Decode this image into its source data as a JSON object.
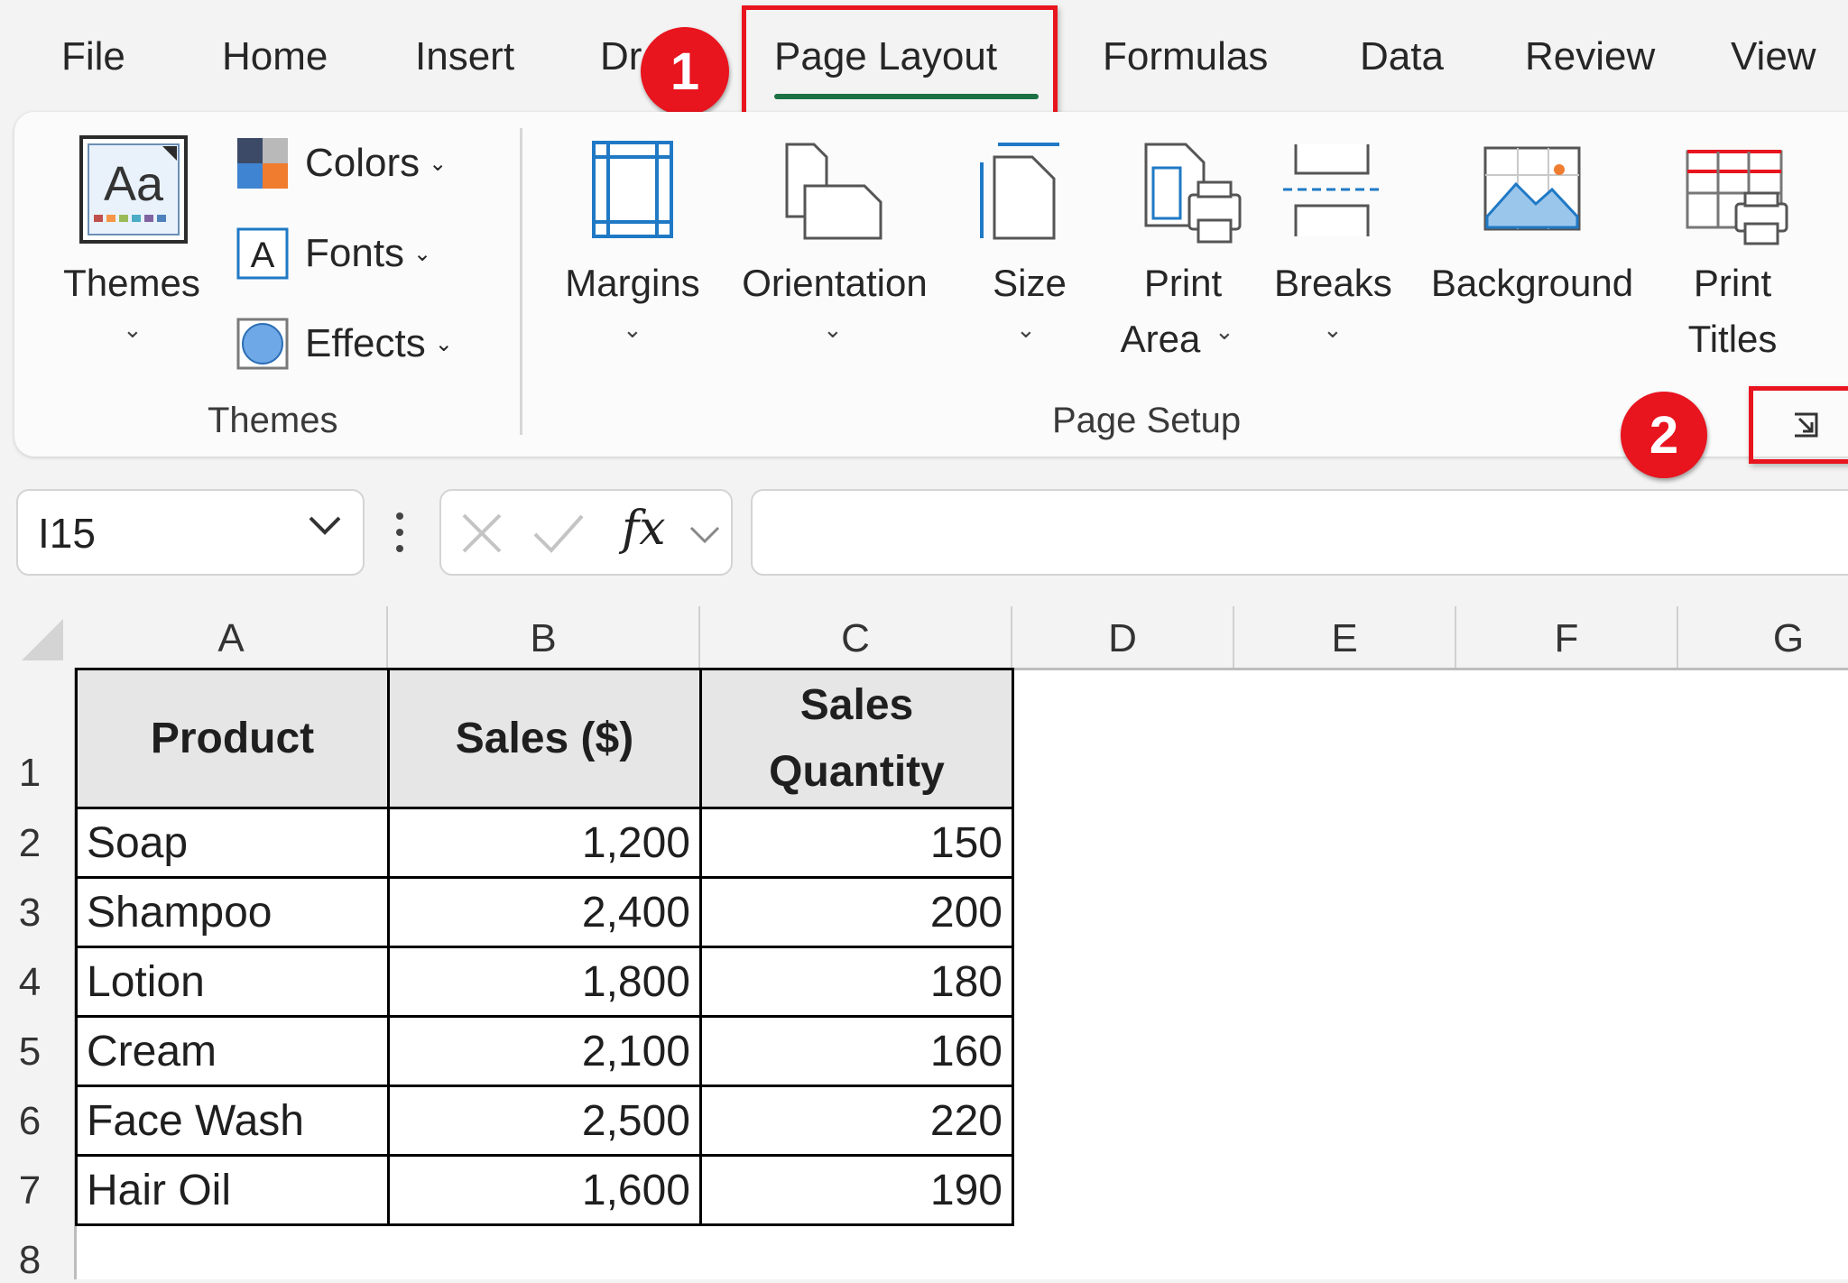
{
  "tabs": [
    "File",
    "Home",
    "Insert",
    "Dr",
    "Page Layout",
    "Formulas",
    "Data",
    "Review",
    "View"
  ],
  "annotations": {
    "step1": "1",
    "step2": "2"
  },
  "ribbon": {
    "themes_group": {
      "themes_button": "Themes",
      "colors": "Colors",
      "fonts": "Fonts",
      "effects": "Effects",
      "group_label": "Themes"
    },
    "page_setup_group": {
      "margins": "Margins",
      "orientation": "Orientation",
      "size": "Size",
      "print_area_line1": "Print",
      "print_area_line2": "Area",
      "breaks": "Breaks",
      "background": "Background",
      "print_titles_line1": "Print",
      "print_titles_line2": "Titles",
      "group_label": "Page Setup"
    },
    "glyphs": {
      "chevron": "⌄",
      "themes_icon_text": "Aa",
      "fonts_icon_text": "A"
    }
  },
  "formula_bar": {
    "name_box": "I15",
    "fx_label": "fx",
    "formula": ""
  },
  "sheet": {
    "columns": [
      "A",
      "B",
      "C",
      "D",
      "E",
      "F",
      "G"
    ],
    "rows": [
      "1",
      "2",
      "3",
      "4",
      "5",
      "6",
      "7",
      "8"
    ],
    "headers": {
      "product": "Product",
      "sales": "Sales ($)",
      "qty_line1": "Sales",
      "qty_line2": "Quantity"
    },
    "data": [
      {
        "product": "Soap",
        "sales": "1,200",
        "qty": "150"
      },
      {
        "product": "Shampoo",
        "sales": "2,400",
        "qty": "200"
      },
      {
        "product": "Lotion",
        "sales": "1,800",
        "qty": "180"
      },
      {
        "product": "Cream",
        "sales": "2,100",
        "qty": "160"
      },
      {
        "product": "Face Wash",
        "sales": "2,500",
        "qty": "220"
      },
      {
        "product": "Hair Oil",
        "sales": "1,600",
        "qty": "190"
      }
    ]
  },
  "colors": {
    "accent_green": "#1e7145",
    "highlight_red": "#e8141e",
    "icon_blue": "#1f79c5"
  }
}
